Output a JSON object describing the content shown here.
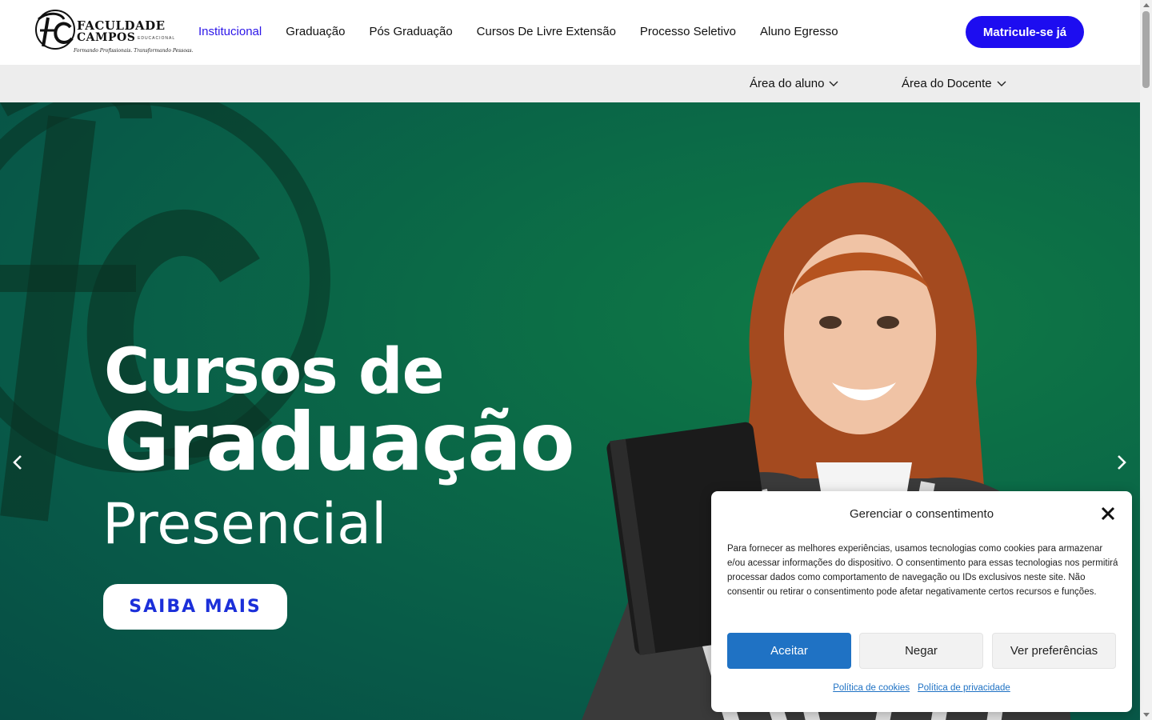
{
  "logo": {
    "monogram": "FC",
    "name_line1": "FACULDADE",
    "name_line2": "CAMPOS",
    "edu_label": "EDUCACIONAL",
    "tagline": "Formando Profissionais. Transformando Pessoas."
  },
  "nav": {
    "items": [
      {
        "label": "Institucional",
        "active": true
      },
      {
        "label": "Graduação"
      },
      {
        "label": "Pós Graduação"
      },
      {
        "label": "Cursos De Livre Extensão"
      },
      {
        "label": "Processo Seletivo"
      },
      {
        "label": "Aluno Egresso"
      }
    ],
    "cta_label": "Matricule-se já"
  },
  "subnav": {
    "items": [
      {
        "label": "Área do aluno"
      },
      {
        "label": "Área do Docente"
      }
    ]
  },
  "hero": {
    "title_line1": "Cursos de",
    "title_line2": "Graduação",
    "title_line3": "Presencial",
    "button_label": "SAIBA MAIS"
  },
  "consent": {
    "title": "Gerenciar o consentimento",
    "body": "Para fornecer as melhores experiências, usamos tecnologias como cookies para armazenar e/ou acessar informações do dispositivo. O consentimento para essas tecnologias nos permitirá processar dados como comportamento de navegação ou IDs exclusivos neste site. Não consentir ou retirar o consentimento pode afetar negativamente certos recursos e funções.",
    "accept_label": "Aceitar",
    "deny_label": "Negar",
    "prefs_label": "Ver preferências",
    "cookie_policy_label": "Política de cookies",
    "privacy_policy_label": "Política de privacidade"
  },
  "colors": {
    "brand_blue": "#1d0df0",
    "active_nav": "#2c16e8",
    "hero_green": "#0b6a47",
    "accept_blue": "#1f72c4"
  },
  "icons": {
    "prev": "chevron-left-icon",
    "next": "chevron-right-icon",
    "close": "close-icon",
    "dropdown": "chevron-down-icon"
  }
}
